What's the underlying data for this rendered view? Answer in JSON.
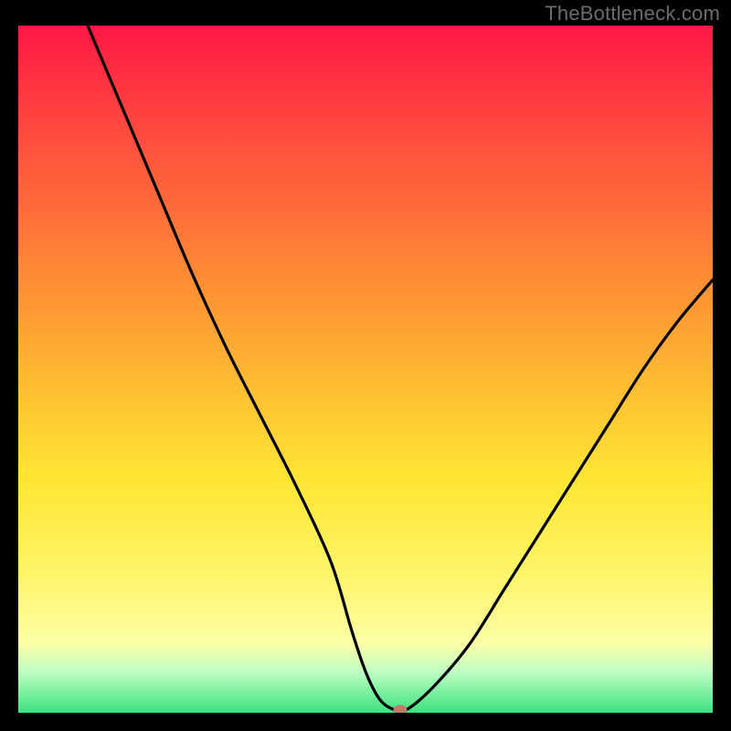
{
  "watermark": "TheBottleneck.com",
  "chart_data": {
    "type": "line",
    "title": "",
    "xlabel": "",
    "ylabel": "",
    "xlim": [
      0,
      100
    ],
    "ylim": [
      0,
      100
    ],
    "gradient_colors": {
      "top": "#ff1744",
      "mid": "#ffe633",
      "bottom": "#3be27e"
    },
    "series": [
      {
        "name": "bottleneck-curve",
        "x": [
          10,
          15,
          20,
          25,
          30,
          35,
          40,
          45,
          48,
          50,
          52,
          54,
          56,
          60,
          65,
          70,
          75,
          80,
          85,
          90,
          95,
          100
        ],
        "y": [
          100,
          88,
          76,
          64,
          53,
          43,
          33,
          22,
          12,
          6,
          2,
          0.5,
          0.5,
          4,
          10,
          18,
          26,
          34,
          42,
          50,
          57,
          63
        ]
      }
    ],
    "marker": {
      "name": "optimum-point",
      "x": 55,
      "y": 0,
      "color": "#c17a65"
    }
  }
}
